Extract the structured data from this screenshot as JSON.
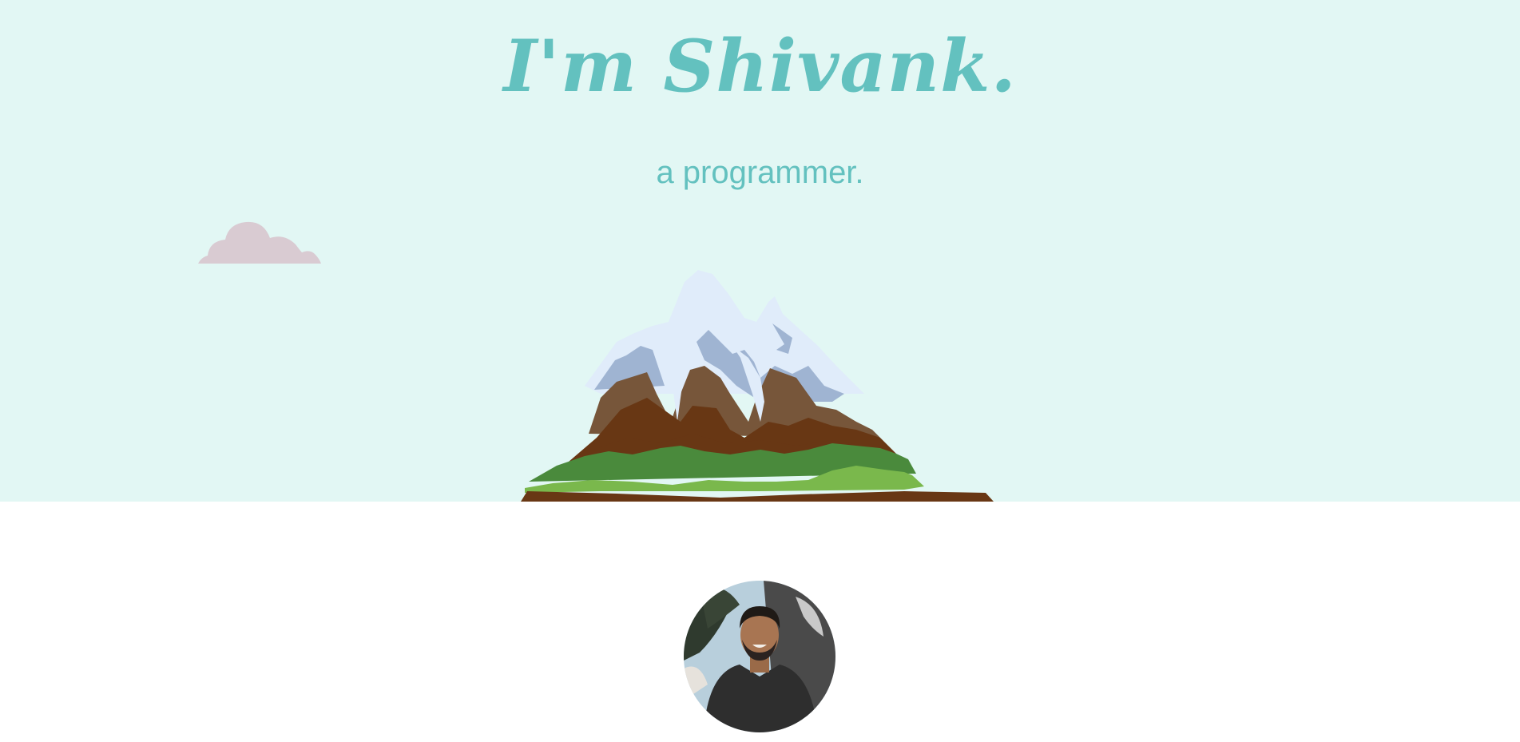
{
  "hero": {
    "title": "I'm Shivank.",
    "subtitle": "a programmer.",
    "illustration": {
      "cloud": "cloud-icon",
      "mountain": "mountain-illustration"
    }
  },
  "about": {
    "avatar": "profile-photo"
  },
  "colors": {
    "sky": "#e2f7f4",
    "accent": "#63c1bf",
    "cloud": "#d9cbd2",
    "snow": "#e0ecfa",
    "snow_shadow": "#9fb4d2",
    "rock_light": "#77563a",
    "rock_dark": "#683714",
    "grass_dark": "#4a8a3c",
    "grass_light": "#7ab84c",
    "page_bg": "#ffffff"
  }
}
